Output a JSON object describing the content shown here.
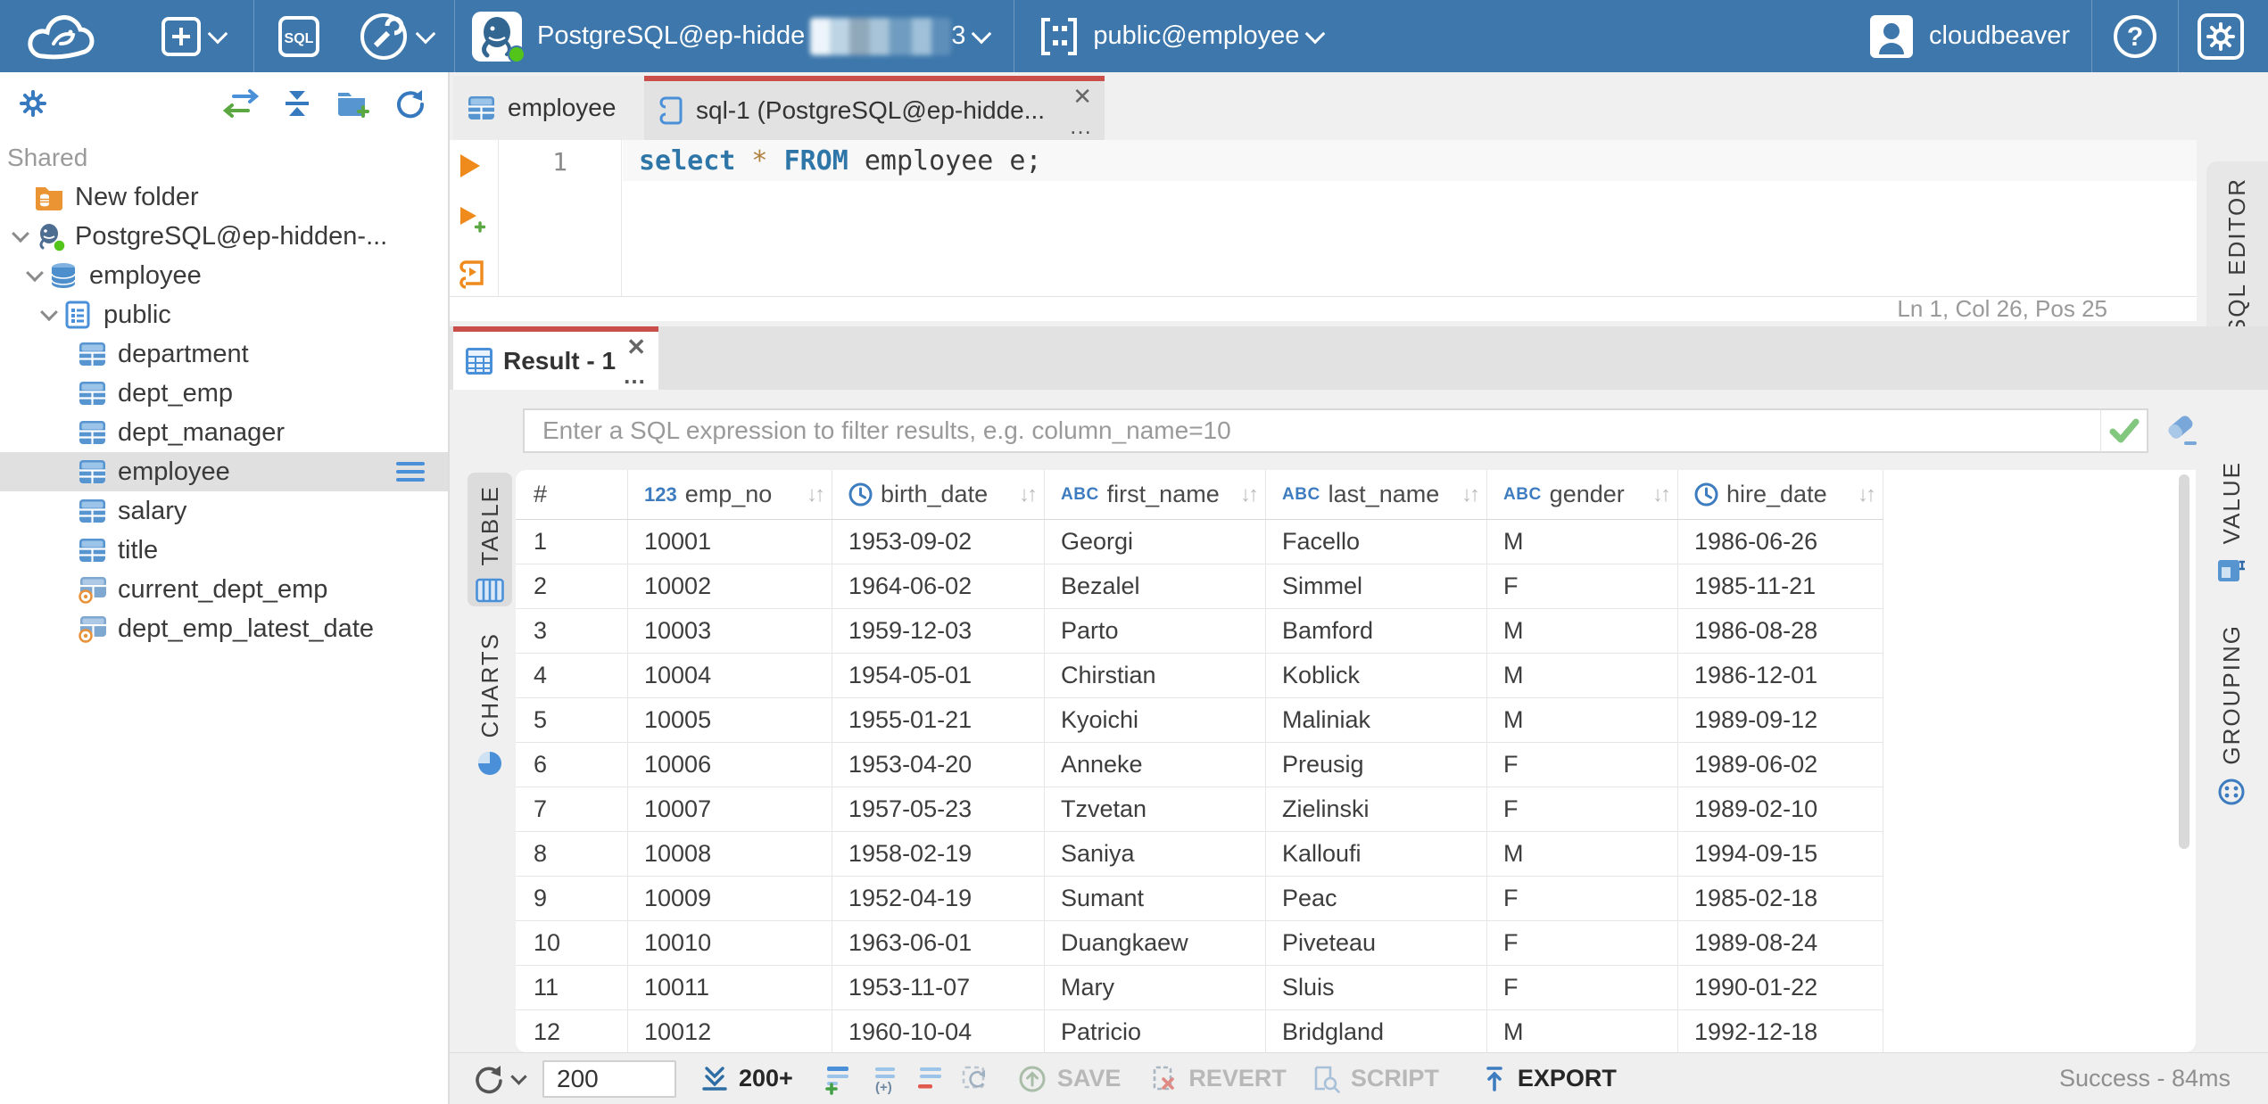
{
  "topbar": {
    "app_name": "CloudBeaver",
    "sql_button_label": "SQL",
    "connection": {
      "visible_name": "PostgreSQL@ep-hidde",
      "censored_tail": "3"
    },
    "schema_selector": "public@employee",
    "user_name": "cloudbeaver"
  },
  "sidebar": {
    "section_label": "Shared",
    "tree": [
      {
        "label": "New folder"
      },
      {
        "label": "PostgreSQL@ep-hidden-..."
      },
      {
        "label": "employee"
      },
      {
        "label": "public"
      },
      {
        "label": "department"
      },
      {
        "label": "dept_emp"
      },
      {
        "label": "dept_manager"
      },
      {
        "label": "employee",
        "selected": true
      },
      {
        "label": "salary"
      },
      {
        "label": "title"
      },
      {
        "label": "current_dept_emp"
      },
      {
        "label": "dept_emp_latest_date"
      }
    ]
  },
  "editor": {
    "tabs": [
      {
        "label": "employee"
      },
      {
        "label": "sql-1 (PostgreSQL@ep-hidde..."
      }
    ],
    "line_number": "1",
    "sql": {
      "t1": "select",
      "t2": " * ",
      "t3": "FROM",
      "t4": " employee e;"
    },
    "caret_status": "Ln 1, Col 26, Pos 25"
  },
  "result": {
    "tab_label": "Result - 1",
    "filter_placeholder": "Enter a SQL expression to filter results, e.g. column_name=10",
    "left_tabs": [
      {
        "label": "TABLE"
      },
      {
        "label": "CHARTS"
      }
    ],
    "right_tabs": [
      {
        "label": "VALUE"
      },
      {
        "label": "GROUPING"
      }
    ],
    "sql_editor_tab": "SQL EDITOR"
  },
  "grid": {
    "columns": [
      {
        "label": "#",
        "type": "index"
      },
      {
        "label": "emp_no",
        "type": "number"
      },
      {
        "label": "birth_date",
        "type": "date"
      },
      {
        "label": "first_name",
        "type": "string"
      },
      {
        "label": "last_name",
        "type": "string"
      },
      {
        "label": "gender",
        "type": "string"
      },
      {
        "label": "hire_date",
        "type": "date"
      }
    ],
    "rows": [
      [
        "1",
        "10001",
        "1953-09-02",
        "Georgi",
        "Facello",
        "M",
        "1986-06-26"
      ],
      [
        "2",
        "10002",
        "1964-06-02",
        "Bezalel",
        "Simmel",
        "F",
        "1985-11-21"
      ],
      [
        "3",
        "10003",
        "1959-12-03",
        "Parto",
        "Bamford",
        "M",
        "1986-08-28"
      ],
      [
        "4",
        "10004",
        "1954-05-01",
        "Chirstian",
        "Koblick",
        "M",
        "1986-12-01"
      ],
      [
        "5",
        "10005",
        "1955-01-21",
        "Kyoichi",
        "Maliniak",
        "M",
        "1989-09-12"
      ],
      [
        "6",
        "10006",
        "1953-04-20",
        "Anneke",
        "Preusig",
        "F",
        "1989-06-02"
      ],
      [
        "7",
        "10007",
        "1957-05-23",
        "Tzvetan",
        "Zielinski",
        "F",
        "1989-02-10"
      ],
      [
        "8",
        "10008",
        "1958-02-19",
        "Saniya",
        "Kalloufi",
        "M",
        "1994-09-15"
      ],
      [
        "9",
        "10009",
        "1952-04-19",
        "Sumant",
        "Peac",
        "F",
        "1985-02-18"
      ],
      [
        "10",
        "10010",
        "1963-06-01",
        "Duangkaew",
        "Piveteau",
        "F",
        "1989-08-24"
      ],
      [
        "11",
        "10011",
        "1953-11-07",
        "Mary",
        "Sluis",
        "F",
        "1990-01-22"
      ],
      [
        "12",
        "10012",
        "1960-10-04",
        "Patricio",
        "Bridgland",
        "M",
        "1992-12-18"
      ]
    ]
  },
  "toolbar": {
    "limit_value": "200",
    "fetch_label": "200+",
    "save_label": "SAVE",
    "revert_label": "REVERT",
    "script_label": "SCRIPT",
    "export_label": "EXPORT",
    "status": "Success - 84ms"
  },
  "glyphs": {
    "close": "✕",
    "more": "…",
    "sort": "↓↑"
  },
  "colors": {
    "topbar_blue": "#3d77ab",
    "accent_red": "#ca4f4b",
    "icon_blue": "#4a90d9",
    "orange": "#ef8a1d",
    "success_green": "#52c41a"
  }
}
